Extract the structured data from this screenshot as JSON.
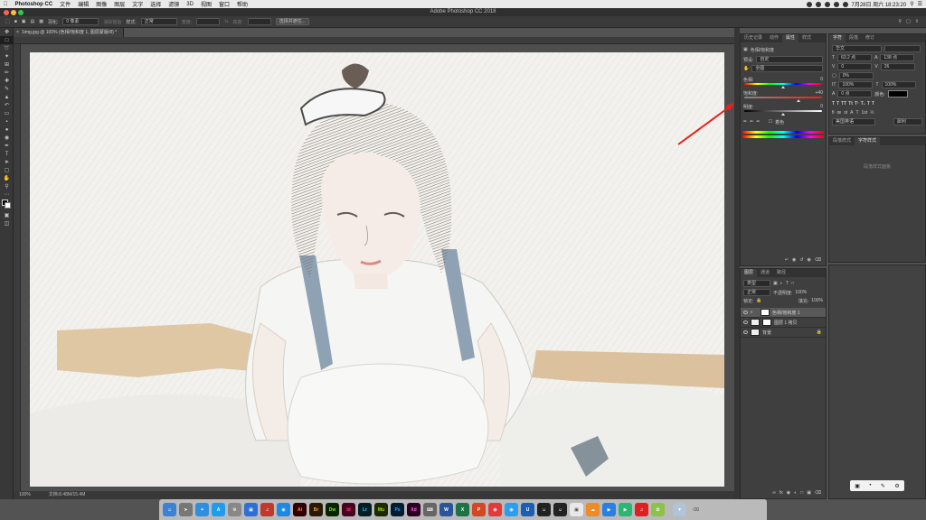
{
  "menubar": {
    "app": "Photoshop CC",
    "items": [
      "文件",
      "编辑",
      "图像",
      "图层",
      "文字",
      "选择",
      "滤镜",
      "3D",
      "视图",
      "窗口",
      "帮助"
    ],
    "clock": "7月28日 周六  18:23:20"
  },
  "window": {
    "title": "Adobe Photoshop CC 2018"
  },
  "options": {
    "feather_label": "羽化:",
    "feather_value": "0 像素",
    "antialias": "消除锯齿",
    "style_label": "样式:",
    "style_value": "正常",
    "width_label": "宽度:",
    "height_label": "高度:",
    "select_mask": "选择并遮住..."
  },
  "document": {
    "tab": "1img.jpg @ 100% (色相/饱和度 1, 图层蒙版/8) *",
    "zoom": "100%",
    "doc_info": "文档:8.48M/15.4M"
  },
  "properties": {
    "tabs": [
      "历史记录",
      "动作",
      "属性",
      "样式"
    ],
    "active_tab": 2,
    "title": "色相/饱和度",
    "preset_label": "预设:",
    "preset_value": "自定",
    "channel_value": "全图",
    "hue_label": "色相:",
    "hue_value": "0",
    "sat_label": "饱和度:",
    "sat_value": "+40",
    "light_label": "明度:",
    "light_value": "0",
    "colorize_label": "着色"
  },
  "character": {
    "tabs": [
      "字符",
      "段落",
      "修订"
    ],
    "font": "华文",
    "size": "63.2 点",
    "leading": "138 点",
    "tracking": "0",
    "kerning": "26",
    "scale_v": "0%",
    "scale_h": "100%",
    "scale_h2": "100%",
    "baseline": "0 点",
    "color_label": "颜色:",
    "lang": "美国英语",
    "aa": "犀利"
  },
  "paragraph": {
    "tabs": [
      "段落样式",
      "字符样式"
    ],
    "empty_msg": "段落样式面板"
  },
  "layers": {
    "tabs": [
      "图层",
      "通道",
      "路径"
    ],
    "filter": "类型",
    "blend_mode": "正常",
    "opacity_label": "不透明度:",
    "opacity_value": "100%",
    "lock_label": "锁定:",
    "fill_label": "填充:",
    "fill_value": "100%",
    "items": [
      {
        "name": "色相/饱和度 1"
      },
      {
        "name": "图层 1 拷贝"
      },
      {
        "name": "背景"
      }
    ]
  },
  "dock": {
    "apps": [
      "Ai",
      "Br",
      "Dw",
      "Id",
      "Lr",
      "Mu",
      "Ps",
      "Xd"
    ]
  },
  "colors": {
    "accent_red": "#e8221c",
    "panel_bg": "#3f3f3f"
  }
}
